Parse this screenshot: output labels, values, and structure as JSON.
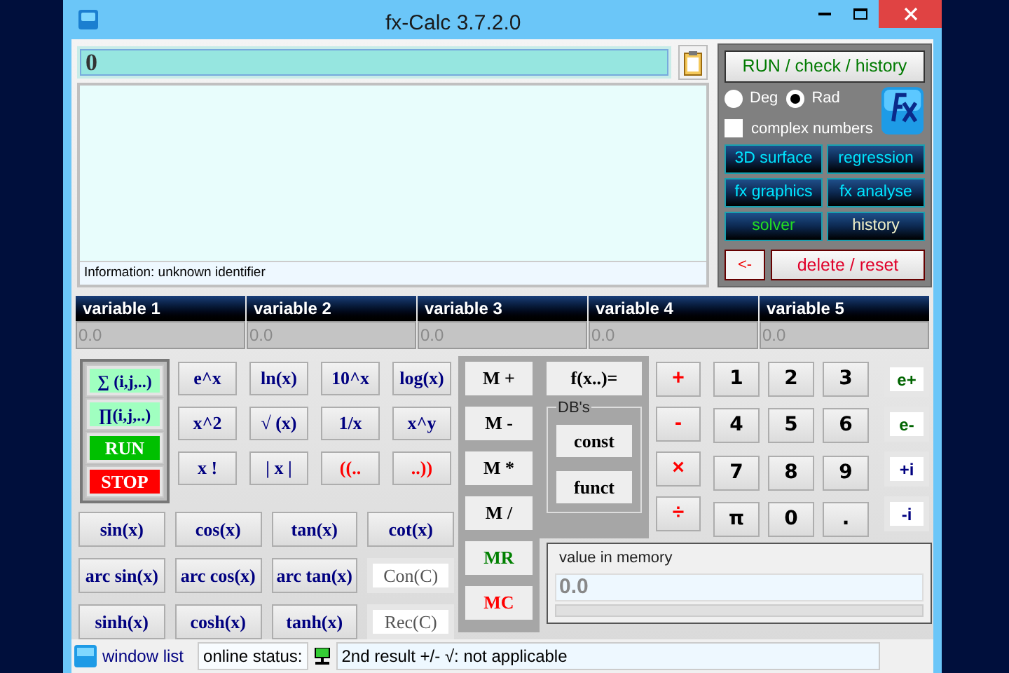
{
  "window": {
    "title": "fx-Calc 3.7.2.0"
  },
  "input": {
    "value": "0"
  },
  "info": "Information: unknown identifier",
  "side": {
    "run_button": "RUN / check / history",
    "angle_modes": [
      {
        "label": "Deg",
        "selected": false
      },
      {
        "label": "Rad",
        "selected": true
      }
    ],
    "complex": {
      "label": "complex numbers",
      "checked": false
    },
    "tools": [
      {
        "label": "3D surface",
        "kind": "tool"
      },
      {
        "label": "regression",
        "kind": "tool"
      },
      {
        "label": "fx graphics",
        "kind": "tool"
      },
      {
        "label": "fx analyse",
        "kind": "tool"
      },
      {
        "label": "solver",
        "kind": "solver"
      },
      {
        "label": "history",
        "kind": "history"
      }
    ],
    "back_button": "<-",
    "reset_button": "delete / reset"
  },
  "variables": [
    {
      "name": "variable 1",
      "value": "0.0"
    },
    {
      "name": "variable 2",
      "value": "0.0"
    },
    {
      "name": "variable 3",
      "value": "0.0"
    },
    {
      "name": "variable 4",
      "value": "0.0"
    },
    {
      "name": "variable 5",
      "value": "0.0"
    }
  ],
  "loop_buttons": [
    {
      "label": "∑ (i,j,..)",
      "kind": "loop"
    },
    {
      "label": "∏(i,j,..)",
      "kind": "loop"
    },
    {
      "label": "RUN",
      "kind": "run"
    },
    {
      "label": "STOP",
      "kind": "stop"
    }
  ],
  "function_keys": [
    {
      "label": "e^x",
      "color": "#000080"
    },
    {
      "label": "ln(x)",
      "color": "#000080"
    },
    {
      "label": "10^x",
      "color": "#000080"
    },
    {
      "label": "log(x)",
      "color": "#000080"
    },
    {
      "label": "x^2",
      "color": "#000080"
    },
    {
      "label": "√ (x)",
      "color": "#000080"
    },
    {
      "label": "1/x",
      "color": "#000080"
    },
    {
      "label": "x^y",
      "color": "#000080"
    },
    {
      "label": "x !",
      "color": "#000080"
    },
    {
      "label": "| x |",
      "color": "#000080"
    },
    {
      "label": "((..",
      "color": "#ff0000"
    },
    {
      "label": "..))",
      "color": "#ff0000"
    }
  ],
  "trig_keys": [
    {
      "label": "sin(x)",
      "kind": "key"
    },
    {
      "label": "cos(x)",
      "kind": "key"
    },
    {
      "label": "tan(x)",
      "kind": "key"
    },
    {
      "label": "cot(x)",
      "kind": "key"
    },
    {
      "label": "arc sin(x)",
      "kind": "key"
    },
    {
      "label": "arc cos(x)",
      "kind": "key"
    },
    {
      "label": "arc tan(x)",
      "kind": "key"
    },
    {
      "label": "Con(C)",
      "kind": "white"
    },
    {
      "label": "sinh(x)",
      "kind": "key"
    },
    {
      "label": "cosh(x)",
      "kind": "key"
    },
    {
      "label": "tanh(x)",
      "kind": "key"
    },
    {
      "label": "Rec(C)",
      "kind": "white"
    }
  ],
  "memory_keys": [
    {
      "label": "M +",
      "color": "#000000"
    },
    {
      "label": "M -",
      "color": "#000000"
    },
    {
      "label": "M *",
      "color": "#000000"
    },
    {
      "label": "M /",
      "color": "#000000"
    },
    {
      "label": "MR",
      "color": "#008000"
    },
    {
      "label": "MC",
      "color": "#ff0000"
    }
  ],
  "fx_button": "f(x..)=",
  "dbs": {
    "title": "DB's",
    "buttons": [
      "const",
      "funct"
    ]
  },
  "operators": [
    "+",
    "-",
    "×",
    "÷"
  ],
  "digits": [
    "1",
    "2",
    "3",
    "4",
    "5",
    "6",
    "7",
    "8",
    "9",
    "π",
    "0",
    "."
  ],
  "complex_keys": [
    {
      "label": "e+",
      "color": "#006400"
    },
    {
      "label": "e-",
      "color": "#006400"
    },
    {
      "label": "+i",
      "color": "#000080"
    },
    {
      "label": "-i",
      "color": "#000080"
    }
  ],
  "memory_display": {
    "label": "value in memory",
    "value": "0.0"
  },
  "status": {
    "window_list": "window list",
    "online_label": "online status:",
    "message": "2nd result +/- √: not applicable"
  }
}
